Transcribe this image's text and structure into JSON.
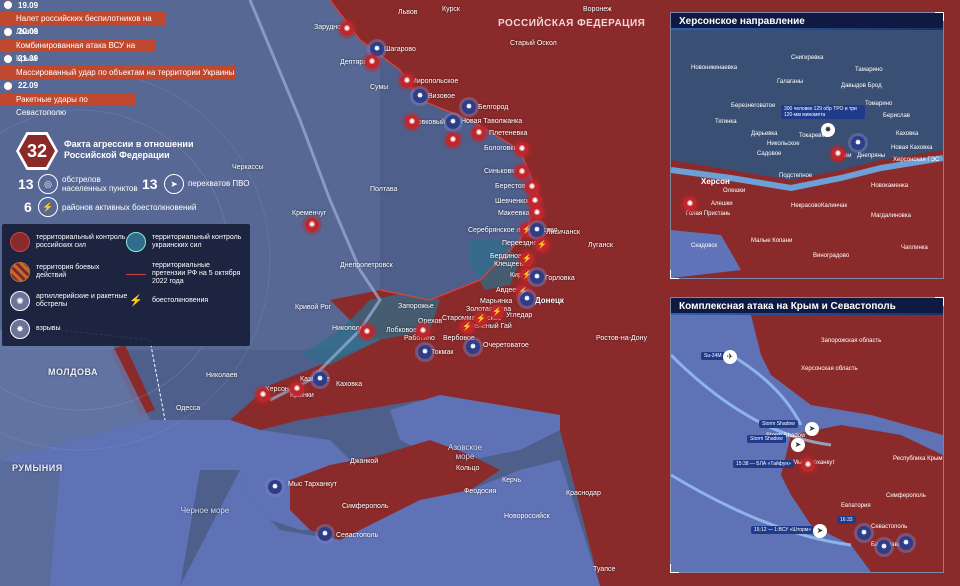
{
  "timeline": [
    {
      "date": "19.09",
      "text": "Налет российских беспилотников на Львов"
    },
    {
      "date": "20.09",
      "text": "Комбинированная атака ВСУ на Крым"
    },
    {
      "date": "21.09",
      "text": "Массированный удар по объектам на территории Украины"
    },
    {
      "date": "22.09",
      "text": "Ракетные удары по Севастополю"
    }
  ],
  "stats": {
    "total": "32",
    "total_label": "Факта агрессии в отношении Российской Федерации",
    "shelling_count": "13",
    "shelling_label": "обстрелов населенных пунктов",
    "intercepts_count": "13",
    "intercepts_label": "перехватов ПВО",
    "combat_count": "6",
    "combat_label": "районов активных боестолкновений"
  },
  "legend": {
    "ru_control": "территориальный контроль российских сил",
    "ua_control": "территориальный контроль украинских сил",
    "combat_zone": "территория боевых действий",
    "claims": "территориальные претензии РФ на 5 октября 2022 года",
    "artillery": "артиллерийские и ракетные обстрелы",
    "clashes": "боестолкновения",
    "explosions": "взрывы"
  },
  "colors": {
    "ru": "#8b2a2a",
    "ua": "#2f6d8a",
    "sea": "#5f74b8",
    "pin_red": "#c0262b",
    "pin_blue": "#2d3d8a"
  },
  "map": {
    "labels": [
      "Львов",
      "Курск",
      "Воронеж",
      "Зарудное",
      "Шагарово",
      "Дептяровка",
      "Мирoпольское",
      "Визовое",
      "Сумы",
      "Белгород",
      "Вовковый",
      "Новая Таволжанка",
      "Плетеневка",
      "Старый Оскол",
      "Черкассы",
      "Полтава",
      "Бологовка",
      "Синьковка",
      "Берестовое",
      "Шевченково",
      "Макеевка",
      "Серебрянское лесничество",
      "Лисичанск",
      "Переездное",
      "Бердиново",
      "Клещеевка",
      "Кирово",
      "Горловка",
      "Авдеевка",
      "Донецк",
      "Марьинка",
      "Угледар",
      "Золотая Нива",
      "Староммайорское",
      "Зеленый Гай",
      "Кременчуг",
      "Днепропетровск",
      "Кривой Рог",
      "Запорожье",
      "Никополь",
      "Лобковое",
      "Работино",
      "Орехов",
      "Вербовое",
      "Токмак",
      "Очеретоватое",
      "Луганск",
      "Ростов-на-Дону",
      "Херсон",
      "Крынки",
      "Казацкое",
      "Каховка",
      "Одесса",
      "Джанкой",
      "Кольцо",
      "Феодосия",
      "Керчь",
      "Новороссийск",
      "Краснодар",
      "Мыс Тарханкут",
      "Симферополь",
      "Севастополь",
      "Туапсе",
      "Николаев"
    ],
    "region_labels": {
      "russia": "РОССИЙСКАЯ ФЕДЕРАЦИЯ",
      "moldova": "МОЛДОВА",
      "romania": "РУМЫНИЯ"
    },
    "seas": {
      "black": "Черное море",
      "azov": "Азовское море"
    }
  },
  "inset_kherson": {
    "title": "Херсонское направление",
    "labels": [
      "Новоникинаевка",
      "Снигиревка",
      "Тамарино",
      "Галаганы",
      "Давыдов Брод",
      "Березнеговатое",
      "Томарино",
      "Берислав",
      "Каховка",
      "Херсон",
      "Крынки",
      "Олешки",
      "Днепряны",
      "Новая Каховка",
      "Алешки",
      "Голая Пристань",
      "Скадовск",
      "Чаплинка",
      "Малые Копани",
      "Виноградово",
      "Калинчак",
      "Новокаменка",
      "Магдалиновка",
      "Некрасово",
      "Садовое",
      "Подстепное",
      "Тягинка",
      "Токаревка",
      "Никольское",
      "Дарьевка",
      "Херсонская ГЭС"
    ],
    "note": "300 человек 129 обр ТРО и три 120-мм миномета"
  },
  "inset_crimea": {
    "title": "Комплексная атака на Крым и Севастополь",
    "labels": [
      "Запорожская область",
      "Херсонская область",
      "Республика Крым",
      "Севастополь",
      "Storm Shadow",
      "Мыс Тарханкут",
      "Симферополь",
      "Евпатория",
      "Балаклава"
    ],
    "tags": [
      "Su-24M",
      "Storm Shadow",
      "Storm Shadow",
      "15:38 — БЛА «Тайфун»",
      "15:12 — 1:ВСУ «Шторм»",
      "16:33"
    ]
  }
}
